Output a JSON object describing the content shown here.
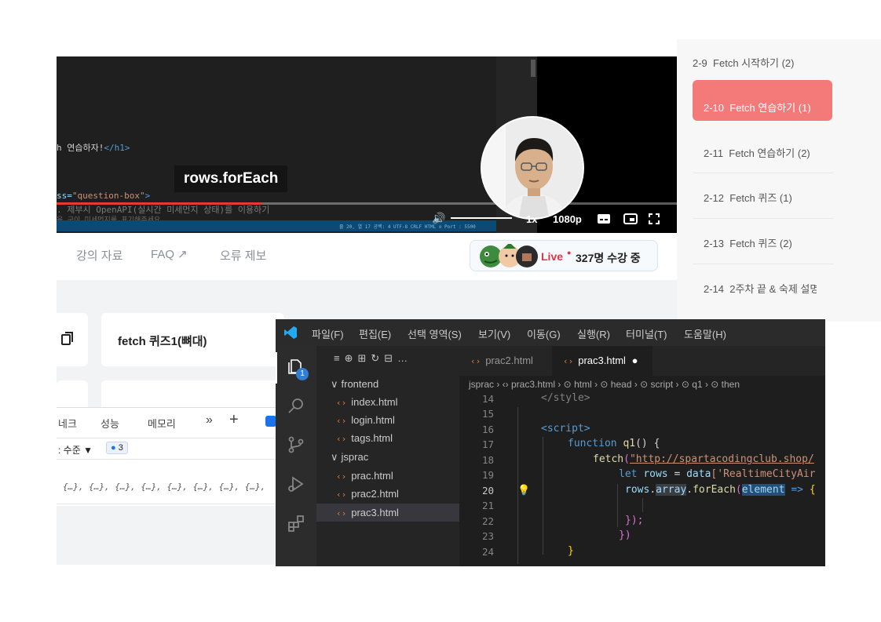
{
  "video": {
    "code_lines": [
      {
        "text": "h 연습하자!",
        "suffix": "</h1>"
      },
      {
        "attr": "ss=",
        "str": "\"question-box\"",
        "suffix": ">"
      },
      {
        "text": ". 제부시 OpenAPI(실시간 미세먼지 상태)를 이용하기"
      },
      {
        "text": "을 구이 미세먼지를 표기해주세요"
      }
    ],
    "statusbar": "줄 20, 열 17   공백: 4   UTF-8   CRLF   HTML   ⊘ Port : 5500",
    "subtitle": "rows.forEach",
    "progress": 0.33,
    "speed": "1x",
    "quality": "1080p"
  },
  "page": {
    "tabs": [
      "강의 자료",
      "FAQ ↗",
      "오류 제보"
    ],
    "live_label": "Live",
    "live_count": "327명 수강 중",
    "card_title": "fetch 퀴즈1(뼈대)"
  },
  "devtools": {
    "tabs": [
      "네크",
      "성능",
      "메모리",
      "»",
      "+"
    ],
    "level": "수준",
    "badge_count": "3",
    "console_text": "{…}, {…}, {…}, {…}, {…}, {…}, {…}, {…},"
  },
  "sidebar": {
    "lessons": [
      {
        "num": "2-9",
        "title": "Fetch 시작하기 (2)"
      },
      {
        "num": "2-10",
        "title": "Fetch 연습하기 (1)",
        "active": true
      },
      {
        "num": "2-11",
        "title": "Fetch 연습하기 (2)"
      },
      {
        "num": "2-12",
        "title": "Fetch 퀴즈 (1)"
      },
      {
        "num": "2-13",
        "title": "Fetch 퀴즈 (2)"
      },
      {
        "num": "2-14",
        "title": "2주차 끝 & 숙제 설명"
      }
    ],
    "active_color": "#f47a7a"
  },
  "vscode": {
    "menu": [
      "파일(F)",
      "편집(E)",
      "선택 영역(S)",
      "보기(V)",
      "이동(G)",
      "실행(R)",
      "터미널(T)",
      "도움말(H)"
    ],
    "explorer_badge": "1",
    "tabs": [
      {
        "name": "prac2.html",
        "active": false
      },
      {
        "name": "prac3.html",
        "active": true,
        "dirty": "●"
      }
    ],
    "breadcrumb": "jsprac › ‹› prac3.html › ⊙ html › ⊙ head › ⊙ script › ⊙ q1 › ⊙ then",
    "tree": [
      {
        "label": "frontend",
        "folder": true
      },
      {
        "label": "index.html"
      },
      {
        "label": "login.html"
      },
      {
        "label": "tags.html"
      },
      {
        "label": "jsprac",
        "folder": true
      },
      {
        "label": "prac.html"
      },
      {
        "label": "prac2.html"
      },
      {
        "label": "prac3.html",
        "selected": true
      }
    ],
    "line_numbers": [
      "14",
      "15",
      "16",
      "17",
      "18",
      "19",
      "20",
      "21",
      "22",
      "23",
      "24"
    ],
    "current_line": "20",
    "code": {
      "l14": "</style>",
      "l16": "<script>",
      "l17_kw": "function",
      "l17_fn": "q1",
      "l17_rest": "() {",
      "l18_fn": "fetch",
      "l18_url": "\"http://spartacodingclub.shop/",
      "l19_kw": "let",
      "l19_var": "rows",
      "l19_rest": " = ",
      "l19_var2": "data",
      "l19_str": "['RealtimeCityAir",
      "l20_var": "rows",
      "l20_prop": "array",
      "l20_fn": "forEach",
      "l20_param": "element",
      "l20_arrow": "=>",
      "l22": "});",
      "l23": "})",
      "l24": "}"
    }
  }
}
